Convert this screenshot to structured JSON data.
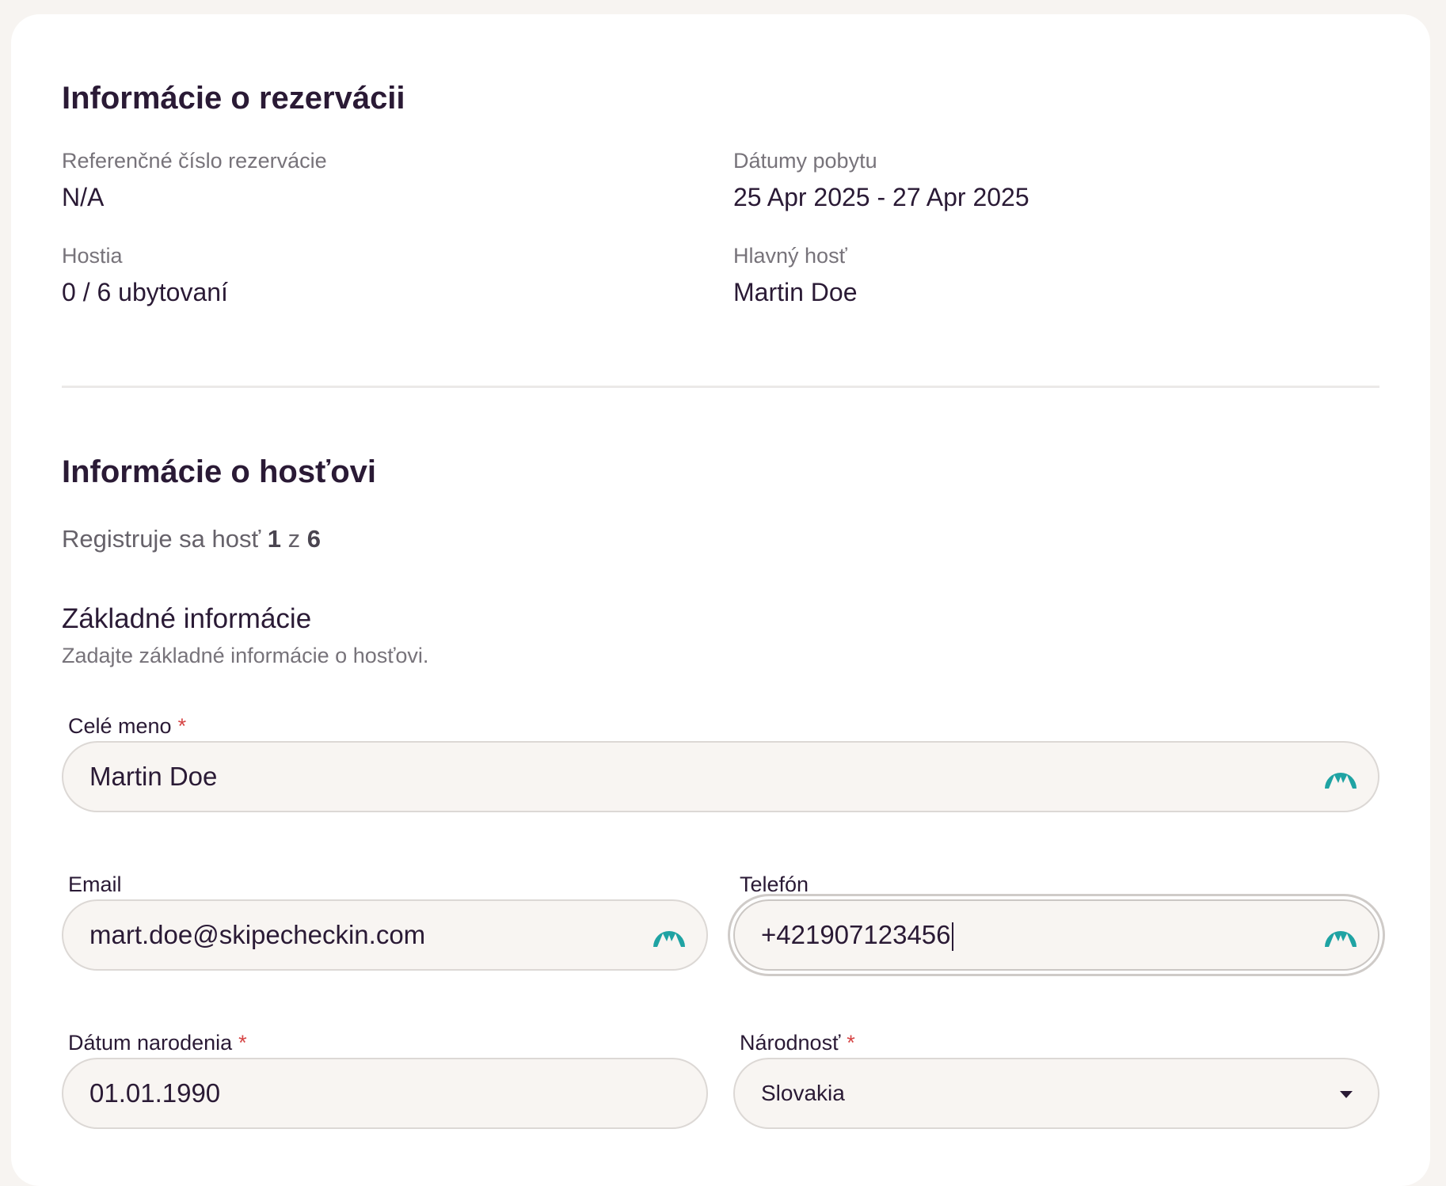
{
  "reservation": {
    "title": "Informácie o rezervácii",
    "reference_label": "Referenčné číslo rezervácie",
    "reference_value": "N/A",
    "dates_label": "Dátumy pobytu",
    "dates_value": "25 Apr 2025 - 27 Apr 2025",
    "guests_label": "Hostia",
    "guests_value": "0 / 6 ubytovaní",
    "main_guest_label": "Hlavný hosť",
    "main_guest_value": "Martin Doe"
  },
  "guest": {
    "title": "Informácie o hosťovi",
    "registering_prefix": "Registruje sa hosť",
    "registering_current": "1",
    "registering_of": "z",
    "registering_total": "6"
  },
  "basic_info": {
    "title": "Základné informácie",
    "subtitle": "Zadajte základné informácie o hosťovi.",
    "required_mark": "*",
    "full_name_label": "Celé meno",
    "full_name_value": "Martin Doe",
    "email_label": "Email",
    "email_value": "mart.doe@skipecheckin.com",
    "phone_label": "Telefón",
    "phone_value": "+421907123456",
    "dob_label": "Dátum narodenia",
    "dob_value": "01.01.1990",
    "nationality_label": "Národnosť",
    "nationality_value": "Slovakia"
  },
  "icons": {
    "autofill": "nordpass-autofill-icon",
    "dropdown": "chevron-down-icon"
  },
  "colors": {
    "accent_teal": "#1fa3a3",
    "required": "#d64545",
    "text_dark": "#2a1a35"
  }
}
